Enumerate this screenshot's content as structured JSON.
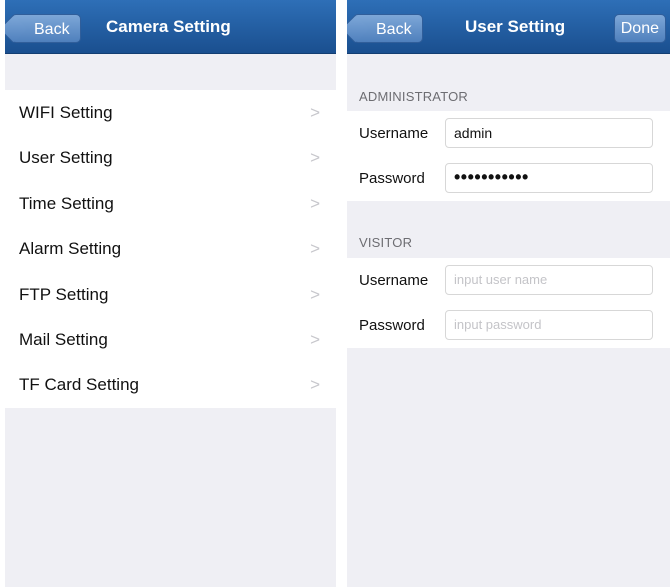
{
  "camera_screen": {
    "back_label": "Back",
    "title": "Camera Setting",
    "items": [
      {
        "label": "WIFI Setting",
        "chevron": ">"
      },
      {
        "label": "User Setting",
        "chevron": ">"
      },
      {
        "label": "Time Setting",
        "chevron": ">"
      },
      {
        "label": "Alarm Setting",
        "chevron": ">"
      },
      {
        "label": "FTP Setting",
        "chevron": ">"
      },
      {
        "label": "Mail Setting",
        "chevron": ">"
      },
      {
        "label": "TF Card Setting",
        "chevron": ">"
      }
    ]
  },
  "user_screen": {
    "back_label": "Back",
    "title": "User Setting",
    "done_label": "Done",
    "administrator": {
      "header": "ADMINISTRATOR",
      "username_label": "Username",
      "username_value": "admin",
      "password_label": "Password",
      "password_value": "•••••••••••"
    },
    "visitor": {
      "header": "VISITOR",
      "username_label": "Username",
      "username_placeholder": "input user name",
      "password_label": "Password",
      "password_placeholder": "input password"
    }
  },
  "colors": {
    "navbar": "#1f5a9e",
    "background": "#efeff4",
    "chevron": "#c7c7cc"
  }
}
